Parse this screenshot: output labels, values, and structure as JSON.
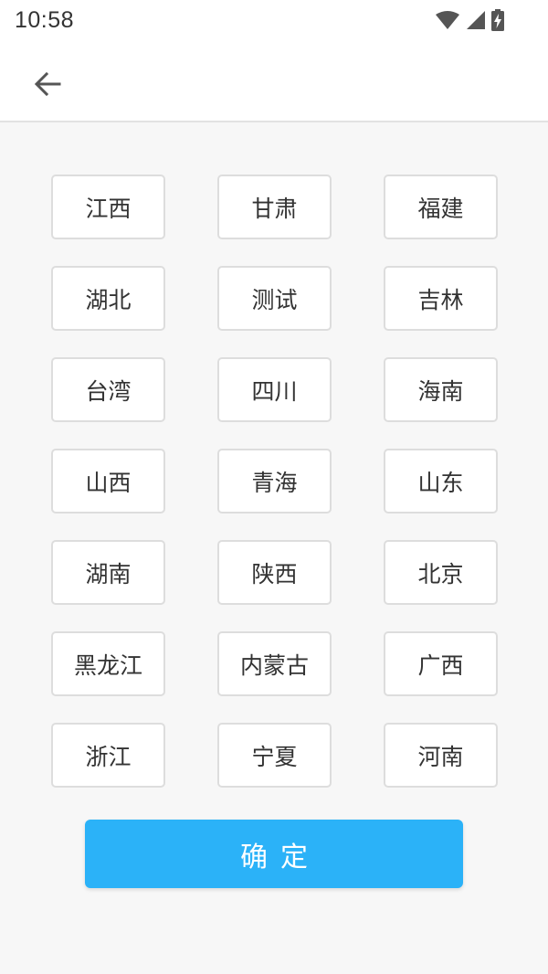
{
  "status_bar": {
    "time": "10:58",
    "icons": [
      "wifi-icon",
      "cellular-signal-icon",
      "battery-charging-icon"
    ]
  },
  "toolbar": {
    "back_icon": "arrow-left-icon"
  },
  "provinces": [
    "江西",
    "甘肃",
    "福建",
    "湖北",
    "测试",
    "吉林",
    "台湾",
    "四川",
    "海南",
    "山西",
    "青海",
    "山东",
    "湖南",
    "陕西",
    "北京",
    "黑龙江",
    "内蒙古",
    "广西",
    "浙江",
    "宁夏",
    "河南"
  ],
  "confirm_label": "确定",
  "colors": {
    "accent": "#2bb2f8",
    "background": "#f7f7f7",
    "button_border": "#dddddd",
    "text": "#333333"
  }
}
